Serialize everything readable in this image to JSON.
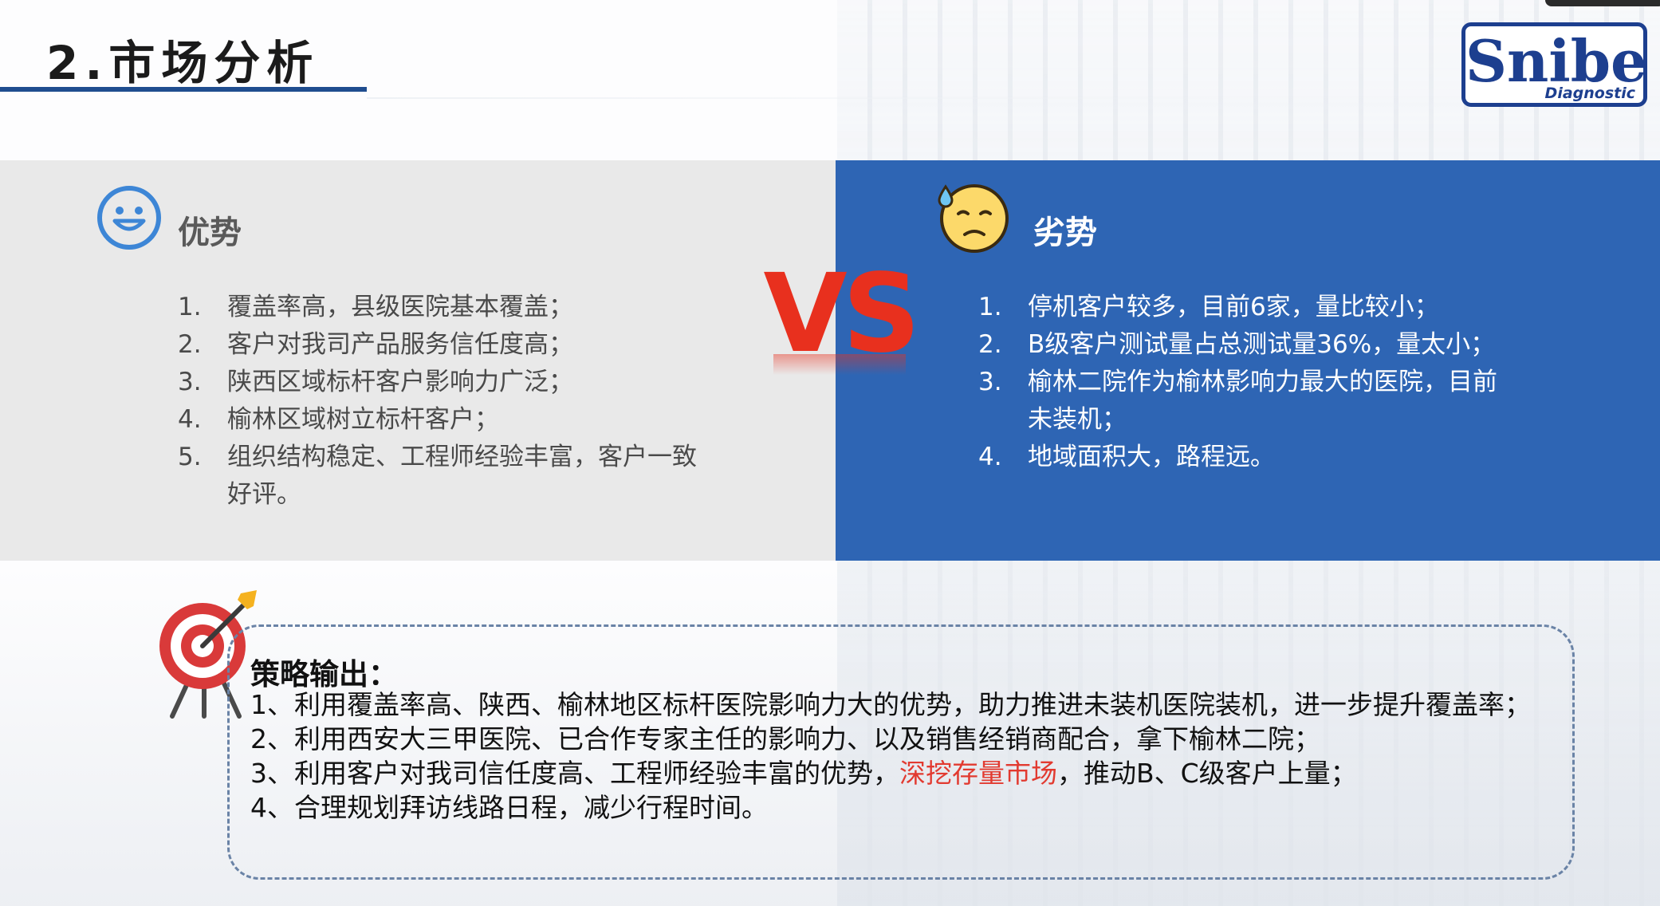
{
  "title": "2.市场分析",
  "logo": {
    "word": "Snibe",
    "sub": "Diagnostic"
  },
  "advantages": {
    "heading": "优势",
    "items": [
      {
        "num": "1.",
        "text": "覆盖率高，县级医院基本覆盖；"
      },
      {
        "num": "2.",
        "text": "客户对我司产品服务信任度高；"
      },
      {
        "num": "3.",
        "text": "陕西区域标杆客户影响力广泛；"
      },
      {
        "num": "4.",
        "text": "榆林区域树立标杆客户；"
      },
      {
        "num": "5.",
        "text": "组织结构稳定、工程师经验丰富，客户一致好评。"
      }
    ]
  },
  "vs_text": "VS",
  "disadvantages": {
    "heading": "劣势",
    "items": [
      {
        "num": "1.",
        "text": "停机客户较多，目前6家，量比较小；"
      },
      {
        "num": "2.",
        "text": "B级客户测试量占总测试量36%，量太小；"
      },
      {
        "num": "3.",
        "text": "榆林二院作为榆林影响力最大的医院，目前未装机；"
      },
      {
        "num": "4.",
        "text": "地域面积大，路程远。"
      }
    ]
  },
  "strategy": {
    "heading": "策略输出：",
    "items": [
      {
        "num": "1、",
        "text": "利用覆盖率高、陕西、榆林地区标杆医院影响力大的优势，助力推进未装机医院装机，进一步提升覆盖率；"
      },
      {
        "num": "2、",
        "text": "利用西安大三甲医院、已合作专家主任的影响力、以及销售经销商配合，拿下榆林二院；"
      },
      {
        "num": "3、",
        "text_before": "利用客户对我司信任度高、工程师经验丰富的优势，",
        "highlight": "深挖存量市场",
        "text_after": "，推动B、C级客户上量；"
      },
      {
        "num": "4、",
        "text": "合理规划拜访线路日程，减少行程时间。"
      }
    ]
  },
  "colors": {
    "accent_blue": "#2e65b4",
    "title_underline": "#1f4d8f",
    "vs_red": "#e8301e",
    "highlight_red": "#e23a30"
  },
  "icons": [
    "smile-face-icon",
    "worried-face-icon",
    "target-arrow-icon"
  ]
}
